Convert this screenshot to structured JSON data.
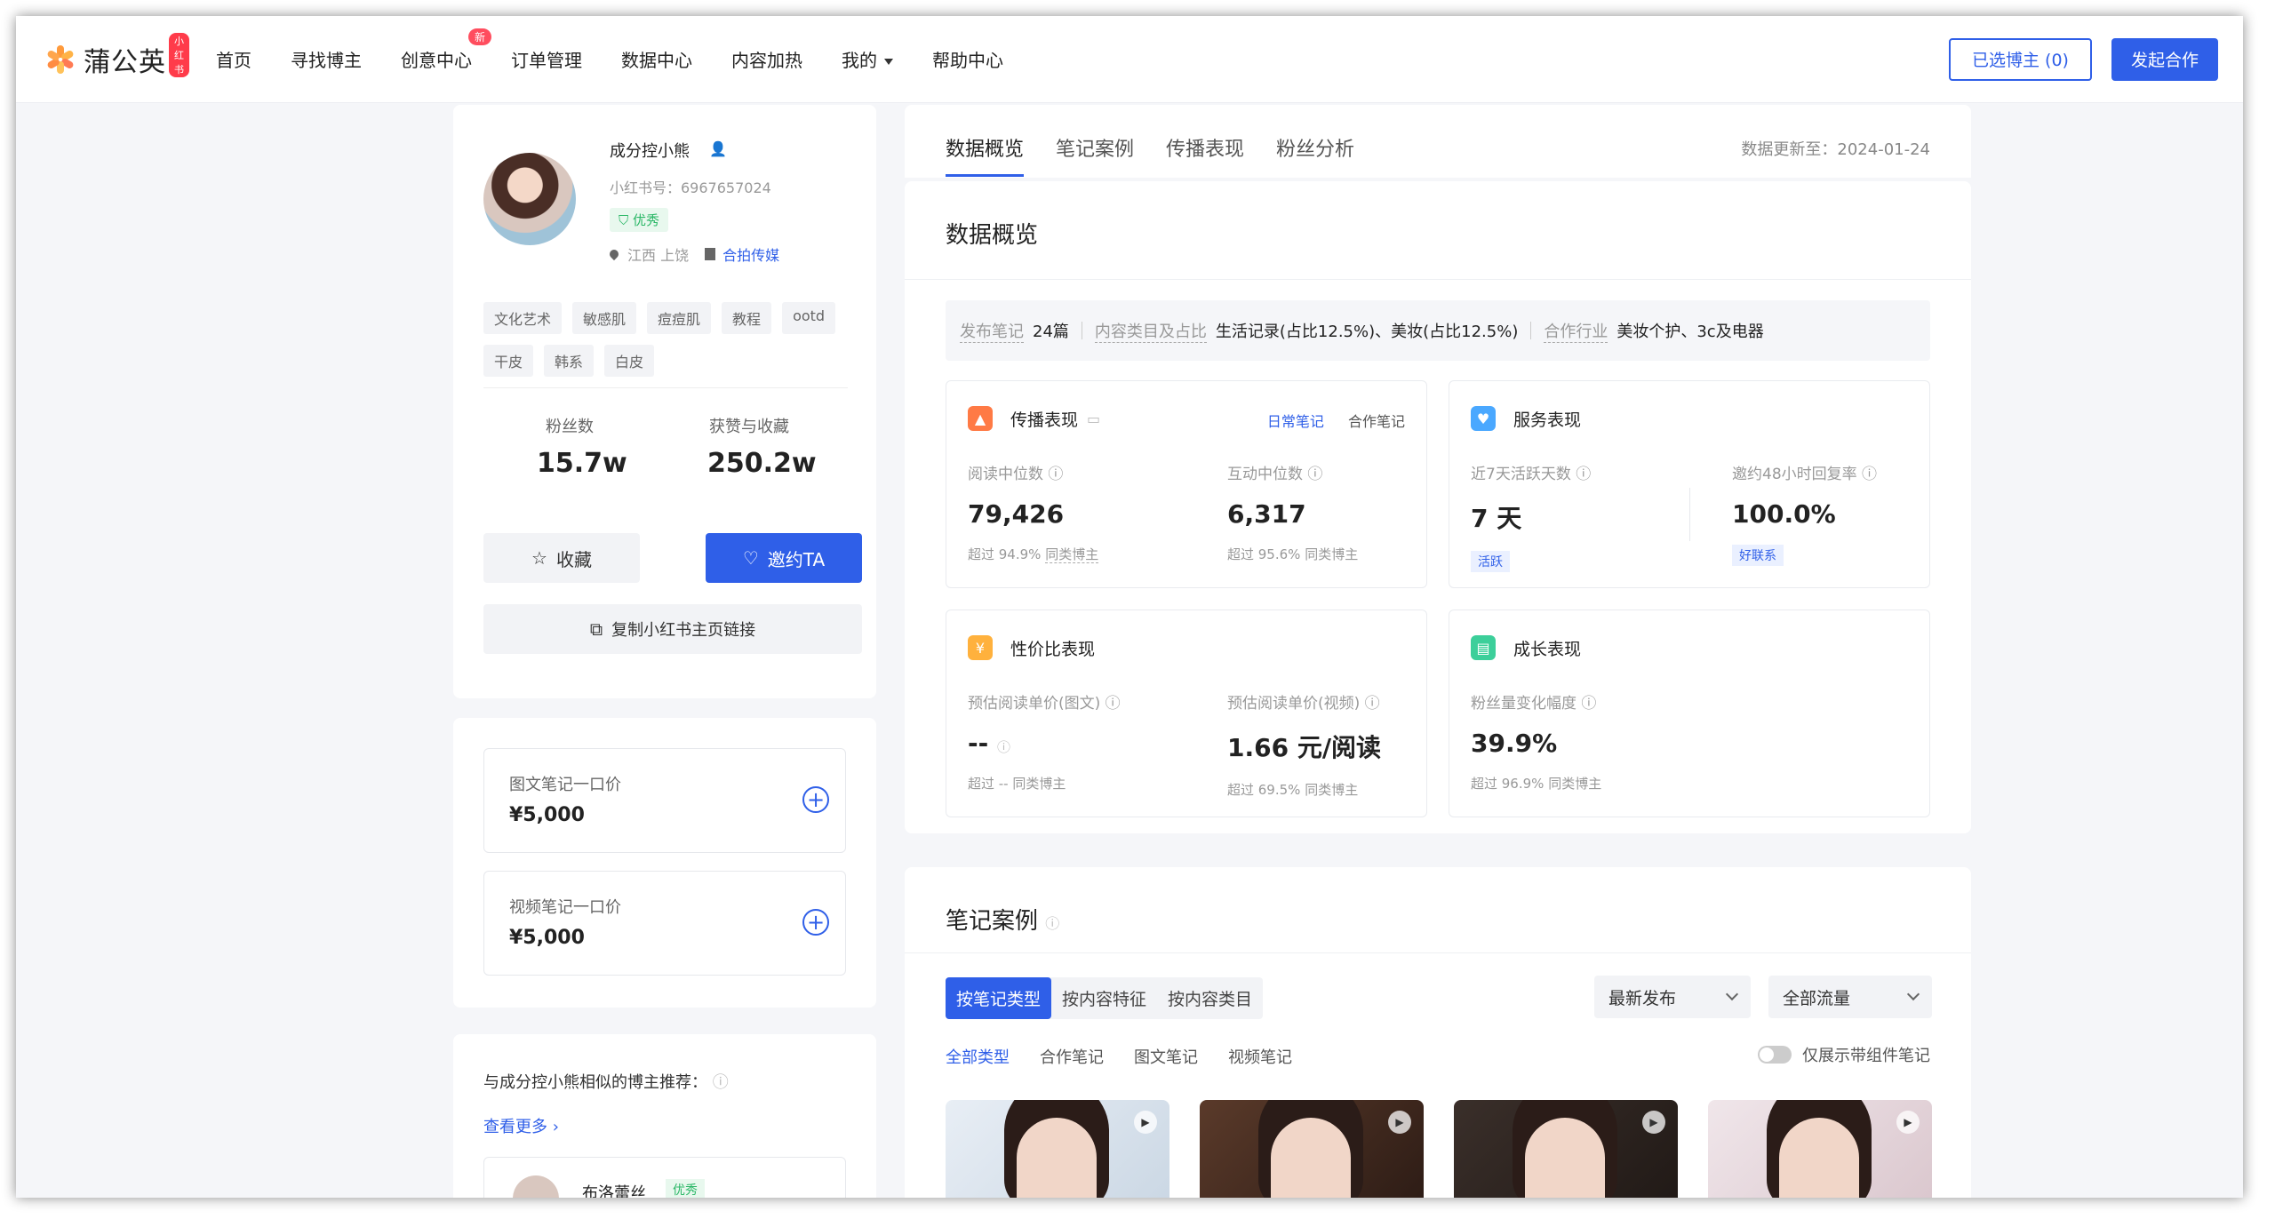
{
  "header": {
    "logo_text": "蒲公英",
    "logo_badge": "小红书",
    "nav": [
      {
        "label": "首页"
      },
      {
        "label": "寻找博主"
      },
      {
        "label": "创意中心",
        "badge": "新"
      },
      {
        "label": "订单管理"
      },
      {
        "label": "数据中心"
      },
      {
        "label": "内容加热"
      },
      {
        "label": "我的"
      },
      {
        "label": "帮助中心"
      }
    ],
    "selected_label": "已选博主 (0)",
    "start_coop_label": "发起合作"
  },
  "profile": {
    "name": "成分控小熊",
    "xhs_id": "小红书号：6967657024",
    "badge": "优秀",
    "location": "江西 上饶",
    "agency": "合拍传媒",
    "tags": [
      "文化艺术",
      "敏感肌",
      "痘痘肌",
      "教程",
      "ootd",
      "干皮",
      "韩系",
      "白皮"
    ],
    "fans_label": "粉丝数",
    "fans_value": "15.7w",
    "likes_label": "获赞与收藏",
    "likes_value": "250.2w",
    "fav_label": "收藏",
    "invite_label": "邀约TA",
    "copy_label": "复制小红书主页链接"
  },
  "prices": [
    {
      "label": "图文笔记一口价",
      "value": "¥5,000"
    },
    {
      "label": "视频笔记一口价",
      "value": "¥5,000"
    }
  ],
  "recommend": {
    "title": "与成分控小熊相似的博主推荐：",
    "more": "查看更多",
    "first_name": "布洛蕾丝",
    "first_badge": "优秀"
  },
  "tabs": {
    "items": [
      "数据概览",
      "笔记案例",
      "传播表现",
      "粉丝分析"
    ],
    "update_text": "数据更新至：2024-01-24"
  },
  "overview": {
    "title": "数据概览",
    "summary": {
      "notes_key": "发布笔记",
      "notes_val": "24篇",
      "category_key": "内容类目及占比",
      "category_val": "生活记录(占比12.5%)、美妆(占比12.5%)",
      "industry_key": "合作行业",
      "industry_val": "美妆个护、3c及电器"
    },
    "spread": {
      "title": "传播表现",
      "tab_daily": "日常笔记",
      "tab_coop": "合作笔记",
      "m1_label": "阅读中位数",
      "m1_value": "79,426",
      "m1_sub_a": "超过 94.9%",
      "m1_sub_b": "同类博主",
      "m2_label": "互动中位数",
      "m2_value": "6,317",
      "m2_sub_a": "超过 95.6%",
      "m2_sub_b": "同类博主"
    },
    "service": {
      "title": "服务表现",
      "m1_label": "近7天活跃天数",
      "m1_value": "7 天",
      "m1_chip": "活跃",
      "m2_label": "邀约48小时回复率",
      "m2_value": "100.0%",
      "m2_chip": "好联系"
    },
    "value": {
      "title": "性价比表现",
      "m1_label": "预估阅读单价(图文)",
      "m1_value": "--",
      "m1_sub_a": "超过 --",
      "m1_sub_b": "同类博主",
      "m2_label": "预估阅读单价(视频)",
      "m2_value": "1.66 元/阅读",
      "m2_sub_a": "超过 69.5%",
      "m2_sub_b": "同类博主"
    },
    "growth": {
      "title": "成长表现",
      "m1_label": "粉丝量变化幅度",
      "m1_value": "39.9%",
      "m1_sub_a": "超过 96.9%",
      "m1_sub_b": "同类博主"
    }
  },
  "notes": {
    "title": "笔记案例",
    "seg": [
      "按笔记类型",
      "按内容特征",
      "按内容类目"
    ],
    "sort": "最新发布",
    "traffic": "全部流量",
    "types": [
      "全部类型",
      "合作笔记",
      "图文笔记",
      "视频笔记"
    ],
    "toggle_label": "仅展示带组件笔记"
  },
  "colors": {
    "primary": "#2f5fe8",
    "badge_red": "#ff3b4a",
    "success": "#2bb767"
  }
}
